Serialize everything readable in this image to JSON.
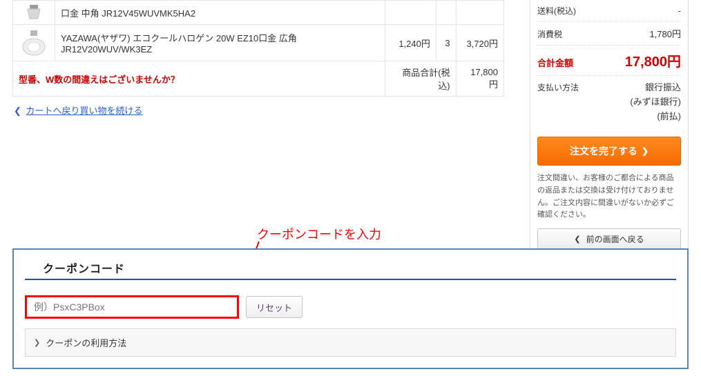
{
  "cart": {
    "rows": [
      {
        "name": "口金 中角 JR12V45WUVMK5HA2",
        "price": "",
        "qty": "",
        "subtotal": ""
      },
      {
        "name": "YAZAWA(ヤザワ) エコクールハロゲン 20W EZ10口金 広角 JR12V20WUV/WK3EZ",
        "price": "1,240円",
        "qty": "3",
        "subtotal": "3,720円"
      }
    ],
    "warning": "型番、W数の間違えはございませんか？",
    "sum_label": "商品合計(税込)",
    "sum_value": "17,800円",
    "back_link": "カートへ戻り買い物を続ける"
  },
  "summary": {
    "shipping_label": "送料(税込)",
    "shipping_value": "-",
    "tax_label": "消費税",
    "tax_value": "1,780円",
    "total_label": "合計金額",
    "total_value": "17,800円",
    "pay_label": "支払い方法",
    "pay_line1": "銀行振込",
    "pay_line2": "(みずほ銀行)",
    "pay_line3": "(前払)",
    "complete_btn": "注文を完了する",
    "note": "注文間違い、お客様のご都合による商品の返品または交換は受け付けておりません。ご注文内容に間違いがないか必ずご確認ください。",
    "back_btn": "前の画面へ戻る"
  },
  "annotation": {
    "text": "クーポンコードを入力"
  },
  "coupon": {
    "title": "クーポンコード",
    "placeholder": "例）PsxC3PBox",
    "reset_btn": "リセット",
    "usage": "クーポンの利用方法"
  }
}
